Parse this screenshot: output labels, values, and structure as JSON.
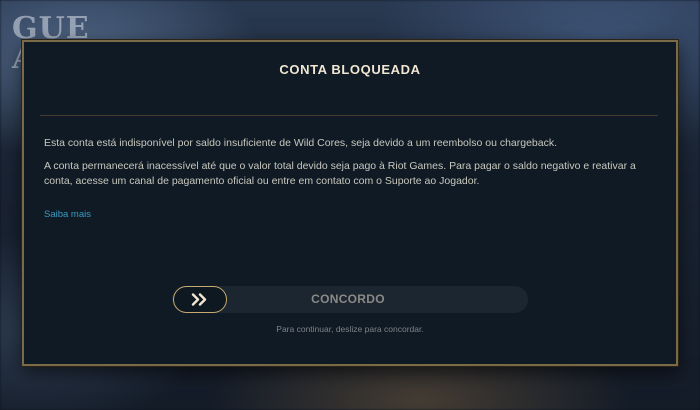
{
  "background": {
    "logo_text": "GUE\nAGE",
    "corner_text": ""
  },
  "dialog": {
    "title": "CONTA BLOQUEADA",
    "paragraph1": "Esta conta está indisponível por saldo insuficiente de Wild Cores, seja devido a um reembolso ou chargeback.",
    "paragraph2": "A conta permanecerá inacessível até que o valor total devido seja pago à Riot Games. Para pagar o saldo negativo e reativar a conta, acesse um canal de pagamento oficial ou entre em contato com o Suporte ao Jogador.",
    "learn_more": "Saiba mais",
    "slider_label": "CONCORDO",
    "slider_hint": "Para continuar, deslize para concordar.",
    "slider_icon": "double-chevron-right-icon"
  },
  "colors": {
    "gold_border": "#7a6a45",
    "handle_gold": "#c8aa6e",
    "link_blue": "#3a9bc4",
    "title_text": "#f0e6d2"
  }
}
